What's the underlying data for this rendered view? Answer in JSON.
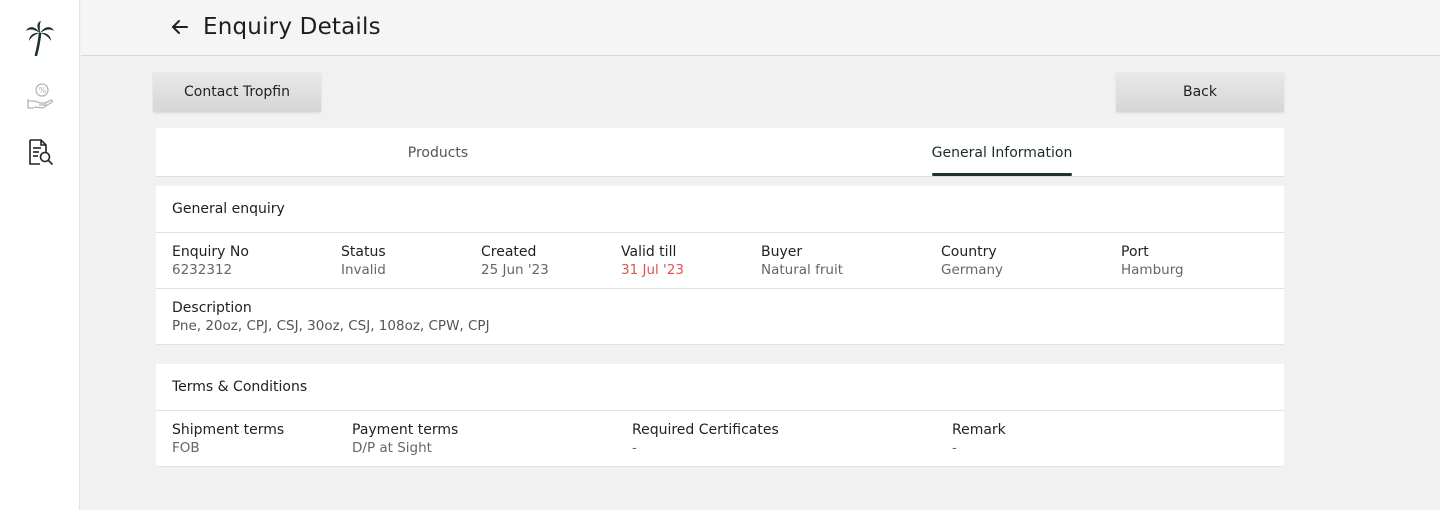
{
  "header": {
    "title": "Enquiry Details"
  },
  "actions": {
    "contact_label": "Contact Tropfin",
    "back_label": "Back"
  },
  "tabs": [
    {
      "label": "Products",
      "active": false
    },
    {
      "label": "General Information",
      "active": true
    }
  ],
  "sidebar": {
    "icons": [
      "palm-tree-logo-icon",
      "hand-percent-icon",
      "document-search-icon"
    ]
  },
  "general": {
    "title": "General enquiry",
    "fields": [
      {
        "label": "Enquiry No",
        "value": "6232312"
      },
      {
        "label": "Status",
        "value": "Invalid"
      },
      {
        "label": "Created",
        "value": "25 Jun '23"
      },
      {
        "label": "Valid till",
        "value": "31 Jul '23"
      },
      {
        "label": "Buyer",
        "value": "Natural fruit"
      },
      {
        "label": "Country",
        "value": "Germany"
      },
      {
        "label": "Port",
        "value": "Hamburg"
      }
    ],
    "description": {
      "label": "Description",
      "value": "Pne, 20oz, CPJ, CSJ, 30oz, CSJ, 108oz, CPW, CPJ"
    }
  },
  "terms": {
    "title": "Terms & Conditions",
    "fields": [
      {
        "label": "Shipment terms",
        "value": "FOB"
      },
      {
        "label": "Payment terms",
        "value": "D/P at Sight"
      },
      {
        "label": "Required Certificates",
        "value": "-"
      },
      {
        "label": "Remark",
        "value": "-"
      }
    ]
  },
  "colors": {
    "accent": "#1c3526",
    "warning": "#e0534d",
    "background": "#f1f1f1"
  }
}
